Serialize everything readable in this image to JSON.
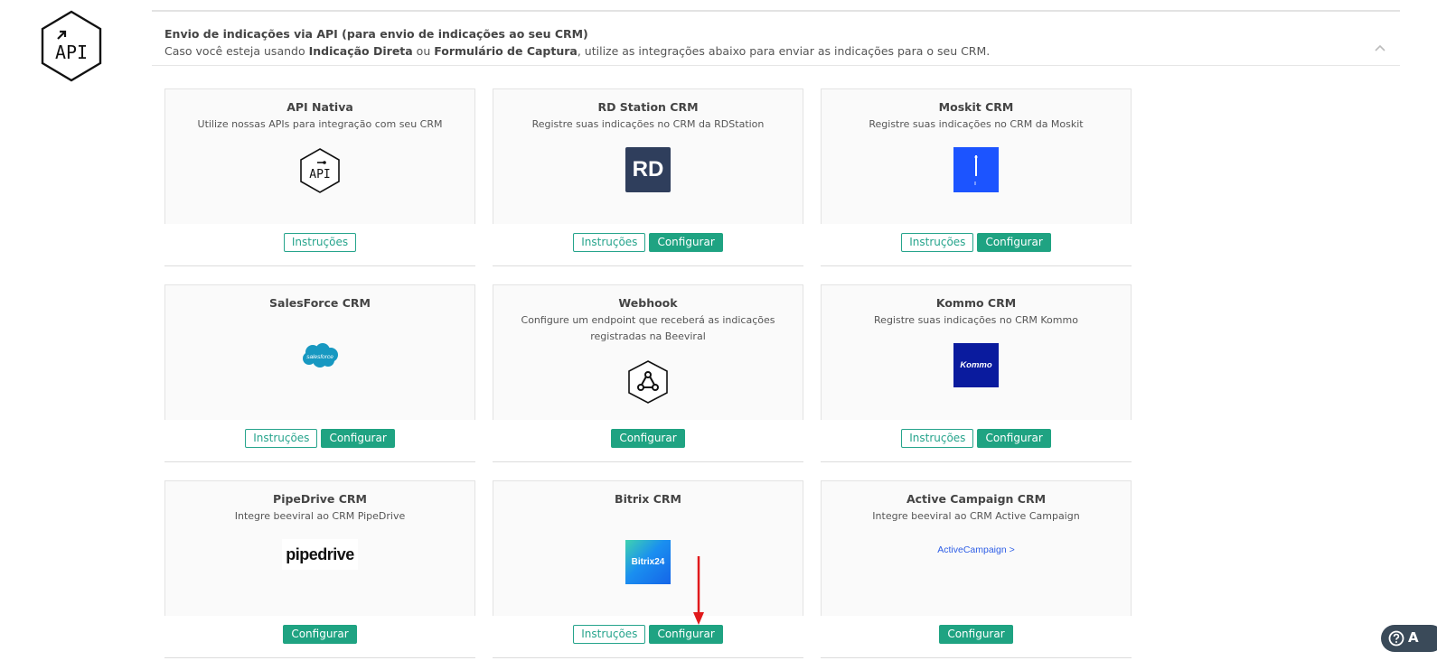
{
  "section": {
    "title": "Envio de indicações via API (para envio de indicações ao seu CRM)",
    "desc_prefix": "Caso você esteja usando ",
    "desc_bold1": "Indicação Direta",
    "desc_mid": " ou ",
    "desc_bold2": "Formulário de Captura",
    "desc_suffix": ", utilize as integrações abaixo para enviar as indicações para o seu CRM."
  },
  "side_icon_text": "API",
  "cards": [
    {
      "title": "API Nativa",
      "desc": "Utilize nossas APIs para integração com seu CRM",
      "logo_text": "API",
      "btn_instructions": "Instruções"
    },
    {
      "title": "RD Station CRM",
      "desc": "Registre suas indicações no CRM da RDStation",
      "logo_text": "RD",
      "btn_instructions": "Instruções",
      "btn_configure": "Configurar"
    },
    {
      "title": "Moskit CRM",
      "desc": "Registre suas indicações no CRM da Moskit",
      "logo_text": "",
      "btn_instructions": "Instruções",
      "btn_configure": "Configurar"
    },
    {
      "title": "SalesForce CRM",
      "desc": "",
      "logo_text": "salesforce",
      "btn_instructions": "Instruções",
      "btn_configure": "Configurar"
    },
    {
      "title": "Webhook",
      "desc": "Configure um endpoint que receberá as indicações registradas na Beeviral",
      "logo_text": "",
      "btn_configure": "Configurar"
    },
    {
      "title": "Kommo CRM",
      "desc": "Registre suas indicações no CRM Kommo",
      "logo_text": "Kommo",
      "btn_instructions": "Instruções",
      "btn_configure": "Configurar"
    },
    {
      "title": "PipeDrive CRM",
      "desc": "Integre beeviral ao CRM PipeDrive",
      "logo_text": "pipedrive",
      "btn_configure": "Configurar"
    },
    {
      "title": "Bitrix CRM",
      "desc": "",
      "logo_text": "Bitrix24",
      "btn_instructions": "Instruções",
      "btn_configure": "Configurar"
    },
    {
      "title": "Active Campaign CRM",
      "desc": "Integre beeviral ao CRM Active Campaign",
      "logo_text": "ActiveCampaign >",
      "btn_configure": "Configurar"
    }
  ],
  "help": {
    "label": "A"
  },
  "colors": {
    "accent": "#1fa382",
    "rd": "#2f3e5c",
    "moskit": "#1c54ff",
    "kommo": "#0a1b9e",
    "salesforce": "#1798c1",
    "annotation": "#e0191b"
  }
}
